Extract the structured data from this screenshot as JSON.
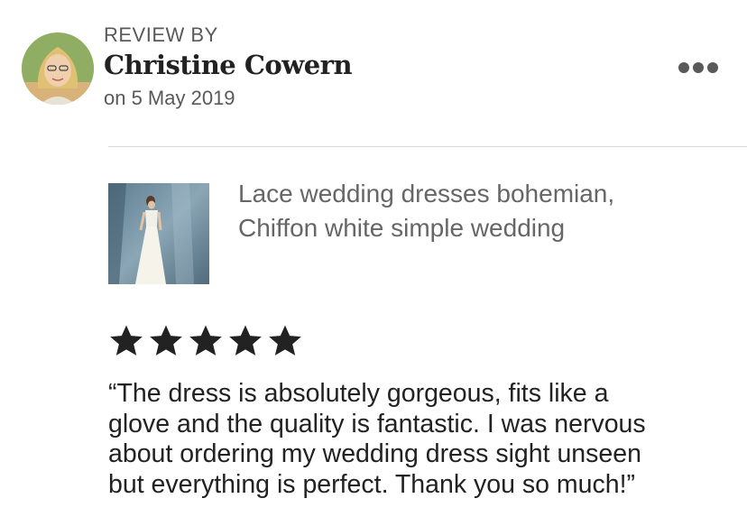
{
  "reviewer": {
    "label": "REVIEW BY",
    "name": "Christine Cowern",
    "date": "on 5 May 2019"
  },
  "product": {
    "title_lines": [
      "Lace wedding dresses bohemian,",
      "Chiffon white simple wedding"
    ]
  },
  "rating": {
    "stars": 5,
    "max": 5
  },
  "review": {
    "lines": [
      "“The dress is absolutely gorgeous, fits like a",
      "glove and the quality is fantastic. I was nervous",
      "about ordering my wedding dress sight unseen",
      "but everything is perfect. Thank you so much!”"
    ]
  },
  "colors": {
    "text_primary": "#222222",
    "text_secondary": "#595959",
    "divider": "#d6d6d6",
    "star": "#222222"
  },
  "icons": {
    "more": "more-dots-icon",
    "star": "star-icon"
  }
}
